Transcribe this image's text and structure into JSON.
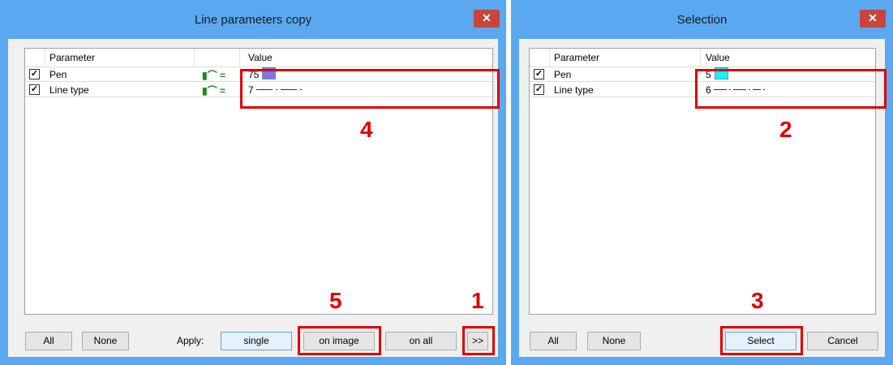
{
  "left_window": {
    "title": "Line parameters copy",
    "close_glyph": "✕",
    "columns": {
      "parameter": "Parameter",
      "value": "Value"
    },
    "rows": [
      {
        "checked": true,
        "name": "Pen",
        "value": "75",
        "swatch_color": "#7777ee",
        "lock_icon": "lock-equals-icon"
      },
      {
        "checked": true,
        "name": "Line type",
        "value": "7",
        "lock_icon": "lock-equals-icon"
      }
    ],
    "buttons": {
      "all": "All",
      "none": "None",
      "apply_label": "Apply:",
      "single": "single",
      "on_image": "on image",
      "on_all": "on all",
      "forward": ">>"
    },
    "annotations": {
      "values_box": "4",
      "on_image": "5",
      "forward": "1"
    }
  },
  "right_window": {
    "title": "Selection",
    "close_glyph": "✕",
    "columns": {
      "parameter": "Parameter",
      "value": "Value"
    },
    "rows": [
      {
        "checked": true,
        "name": "Pen",
        "value": "5",
        "swatch_color": "#00ffff"
      },
      {
        "checked": true,
        "name": "Line type",
        "value": "6"
      }
    ],
    "buttons": {
      "all": "All",
      "none": "None",
      "select": "Select",
      "cancel": "Cancel"
    },
    "annotations": {
      "values_box": "2",
      "select": "3"
    }
  },
  "colors": {
    "window_frame": "#5aa9f0",
    "annotation_red": "#e00000",
    "close_button": "#c7453a"
  }
}
